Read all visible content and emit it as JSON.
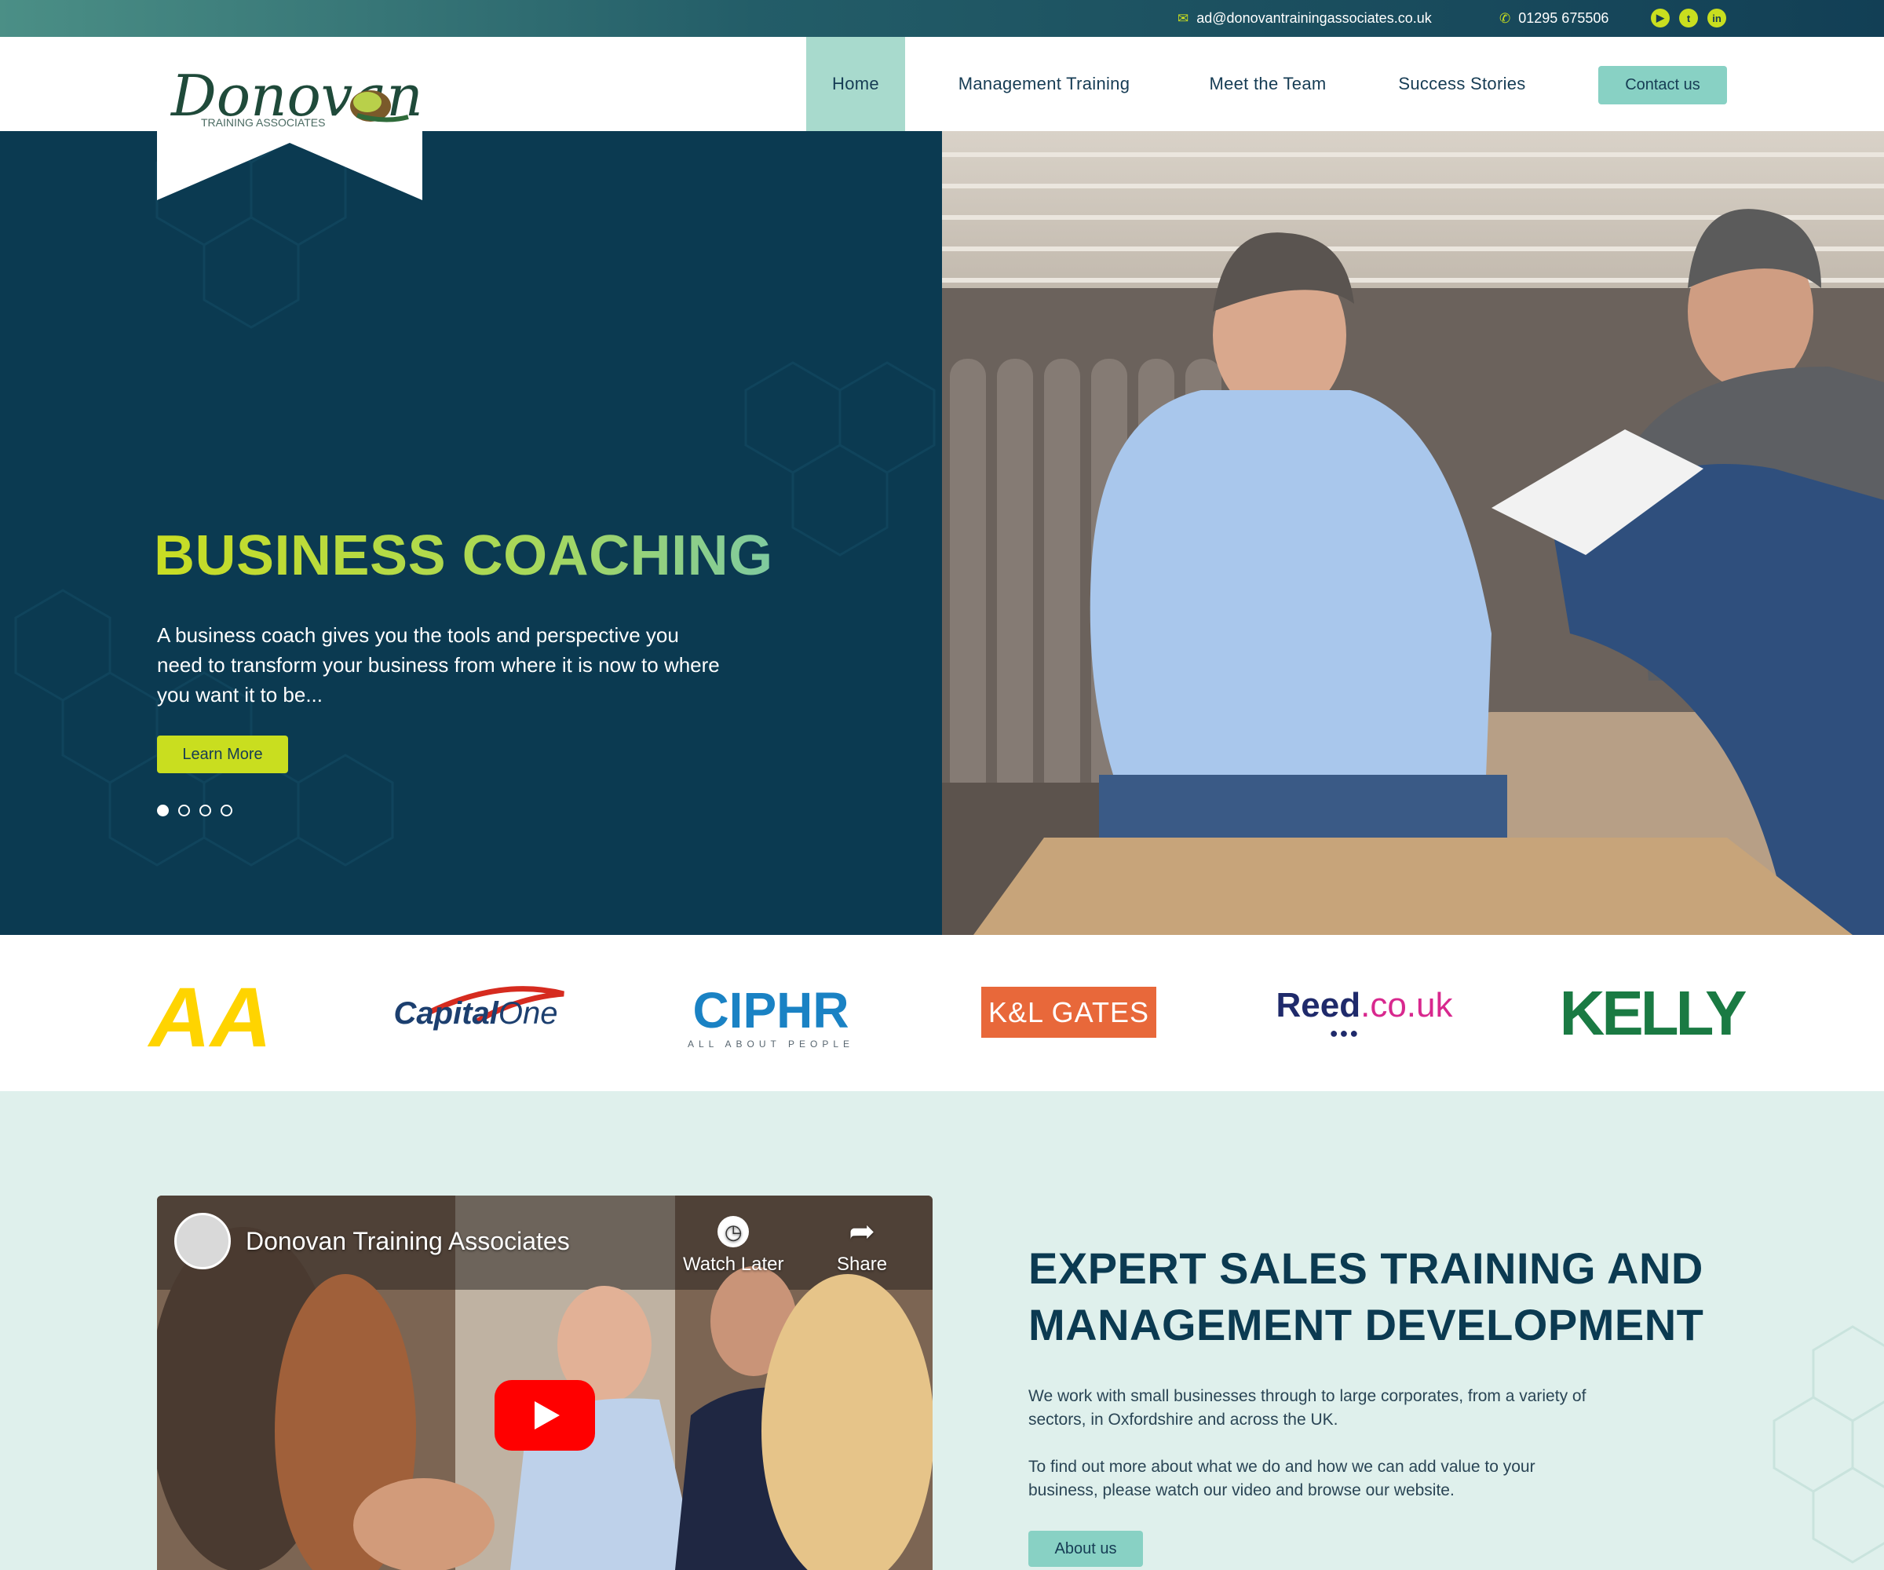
{
  "topbar": {
    "email": "ad@donovantrainingassociates.co.uk",
    "phone": "01295 675506",
    "social": [
      "youtube-icon",
      "twitter-icon",
      "linkedin-icon"
    ]
  },
  "logo": {
    "script": "Donovan",
    "sub": "TRAINING ASSOCIATES"
  },
  "nav": {
    "items": [
      "Home",
      "Management Training",
      "Meet the Team",
      "Success Stories"
    ],
    "active": "Home",
    "contact": "Contact us"
  },
  "hero": {
    "title": "BUSINESS COACHING",
    "text": "A business coach gives you the tools and perspective you need to transform your business from where it is now to where you want it to be...",
    "button": "Learn More",
    "slides": 4,
    "current_slide": 1
  },
  "clients": {
    "aa": "AA",
    "capital_one": {
      "a": "Capital",
      "b": "One"
    },
    "ciphr": {
      "name": "CIPHR",
      "tagline": "ALL ABOUT PEOPLE"
    },
    "klgates": "K&L GATES",
    "reed": {
      "a": "Reed",
      "b": ".co.uk"
    },
    "kelly": "KELLY"
  },
  "video": {
    "channel": "Donovan Training Associates",
    "watch_later": "Watch Later",
    "share": "Share"
  },
  "about": {
    "heading": "EXPERT SALES TRAINING AND MANAGEMENT DEVELOPMENT",
    "para1": "We work with small businesses through to large corporates, from a variety of sectors, in Oxfordshire and across the UK.",
    "para2": "To find out more about what we do and how we can add value to your business, please watch our video and browse our website.",
    "button": "About us"
  },
  "colors": {
    "navy": "#0b3a51",
    "lime": "#c9de1f",
    "mint": "#88d1c4",
    "bg_mint": "#dff0ec"
  }
}
